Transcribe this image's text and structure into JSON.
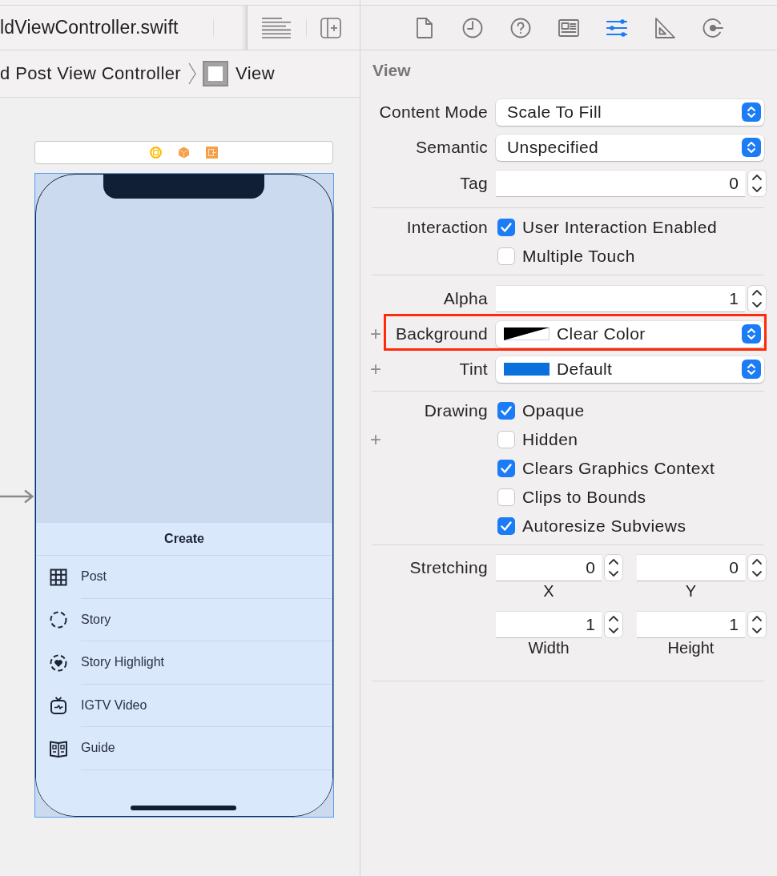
{
  "editor": {
    "tab_title": "ldViewController.swift",
    "breadcrumb": {
      "parent": "d Post View Controller",
      "current": "View"
    }
  },
  "canvas": {
    "sheet_title": "Create",
    "menu": [
      {
        "label": "Post"
      },
      {
        "label": "Story"
      },
      {
        "label": "Story Highlight"
      },
      {
        "label": "IGTV Video"
      },
      {
        "label": "Guide"
      }
    ]
  },
  "inspector_tabs": [
    {
      "selected": false
    },
    {
      "selected": false
    },
    {
      "selected": false
    },
    {
      "selected": false
    },
    {
      "selected": true
    },
    {
      "selected": false
    },
    {
      "selected": false
    }
  ],
  "inspector": {
    "title": "View",
    "sections": [
      {
        "rows": [
          {
            "kind": "popup",
            "label": "Content Mode",
            "value": "Scale To Fill",
            "highlighted": false
          },
          {
            "kind": "popup",
            "label": "Semantic",
            "value": "Unspecified",
            "highlighted": false
          },
          {
            "kind": "number",
            "label": "Tag",
            "value": "0",
            "highlighted": false
          }
        ]
      },
      {
        "rows": [
          {
            "kind": "checks",
            "label": "Interaction",
            "highlighted": false,
            "options": [
              {
                "label": "User Interaction Enabled",
                "checked": true
              },
              {
                "label": "Multiple Touch",
                "checked": false
              }
            ]
          }
        ]
      },
      {
        "rows": [
          {
            "kind": "number",
            "label": "Alpha",
            "value": "1",
            "highlighted": false
          },
          {
            "kind": "color",
            "label": "Background",
            "value": "Clear Color",
            "variation": "+",
            "highlighted": true
          },
          {
            "kind": "color",
            "label": "Tint",
            "value": "Default",
            "color": "#0a70dc",
            "variation": "+",
            "highlighted": false
          }
        ]
      },
      {
        "rows": [
          {
            "kind": "checks",
            "label": "Drawing",
            "highlighted": false,
            "options": [
              {
                "label": "Opaque",
                "checked": true
              },
              {
                "label": "Hidden",
                "checked": false,
                "variation": "+"
              },
              {
                "label": "Clears Graphics Context",
                "checked": true
              },
              {
                "label": "Clips to Bounds",
                "checked": false
              },
              {
                "label": "Autoresize Subviews",
                "checked": true
              }
            ]
          }
        ]
      },
      {
        "rows": [
          {
            "kind": "stretch",
            "label": "Stretching",
            "highlighted": false,
            "fields": [
              {
                "value": "0",
                "caption": "X"
              },
              {
                "value": "0",
                "caption": "Y"
              },
              {
                "value": "1",
                "caption": "Width"
              },
              {
                "value": "1",
                "caption": "Height"
              }
            ]
          }
        ]
      }
    ]
  }
}
